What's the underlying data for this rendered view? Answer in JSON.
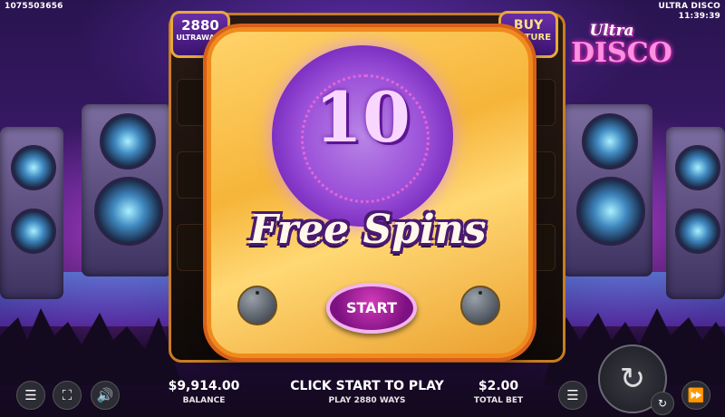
{
  "header": {
    "session_id": "1075503656",
    "game_name": "ULTRA DISCO",
    "clock": "11:39:39"
  },
  "reels_header": {
    "ways_count": "2880",
    "ways_label": "ULTRAWAYS",
    "buy_line1": "BUY",
    "buy_line2": "FEATURE"
  },
  "logo": {
    "line1": "Ultra",
    "line2": "DISCO"
  },
  "popup": {
    "spins_count": "10",
    "title": "Free Spins",
    "start_label": "START"
  },
  "bottom": {
    "balance_value": "$9,914.00",
    "balance_label": "BALANCE",
    "message": "CLICK START TO PLAY",
    "submessage": "PLAY 2880 WAYS",
    "bet_value": "$2.00",
    "bet_label": "TOTAL BET"
  },
  "icons": {
    "menu": "menu-icon",
    "fullscreen": "fullscreen-icon",
    "sound": "speaker-icon",
    "coins": "coin-stack-icon",
    "spin": "spin-arrows-icon",
    "autoplay": "autoplay-icon",
    "turbo": "fast-forward-icon"
  },
  "colors": {
    "popup_gold": "#f6b53a",
    "ring_purple": "#9a4fd8",
    "start_button": "#a31e9a",
    "frame_orange": "#f08a1d"
  }
}
